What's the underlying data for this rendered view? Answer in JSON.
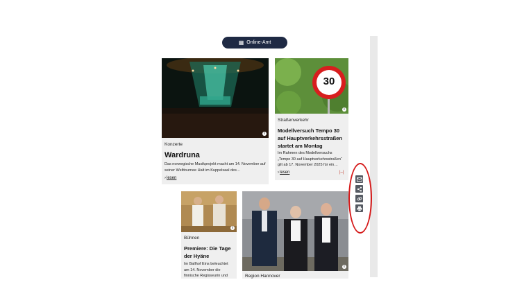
{
  "header": {
    "online_amt_label": "Online-Amt",
    "online_amt_icon": "building-icon"
  },
  "cards": [
    {
      "category": "Konzerte",
      "title": "Wardruna",
      "text": "Das norwegische Musikprojekt macht am 14. November auf seiner Welttournee Halt im Kuppelsaal des…",
      "more": "lesen"
    },
    {
      "category": "Straßenverkehr",
      "title": "Modellversuch Tempo 30 auf Hauptverkehrsstraßen startet am Montag",
      "text": "Im Rahmen des Modellversuchs „Tempo 30 auf Hauptverkehrsstraßen“ gilt ab 17. November 2025 für ein…",
      "more": "lesen",
      "sign_value": "30"
    },
    {
      "category": "Bühnen",
      "title": "Premiere: Die Tage der Hyäne",
      "text": "Im Ballhof Eins beleuchtet am 14. November die finnische Regisseurin und Autorin Saara…"
    },
    {
      "category": "Region Hannover"
    }
  ],
  "share_bar": {
    "icons": [
      "mail-icon",
      "share-icon",
      "link-icon",
      "print-icon"
    ]
  },
  "colors": {
    "button_bg": "#1f2a44",
    "card_bg": "#efefef",
    "highlight": "#d51a1a",
    "share_btn": "#555a62"
  }
}
